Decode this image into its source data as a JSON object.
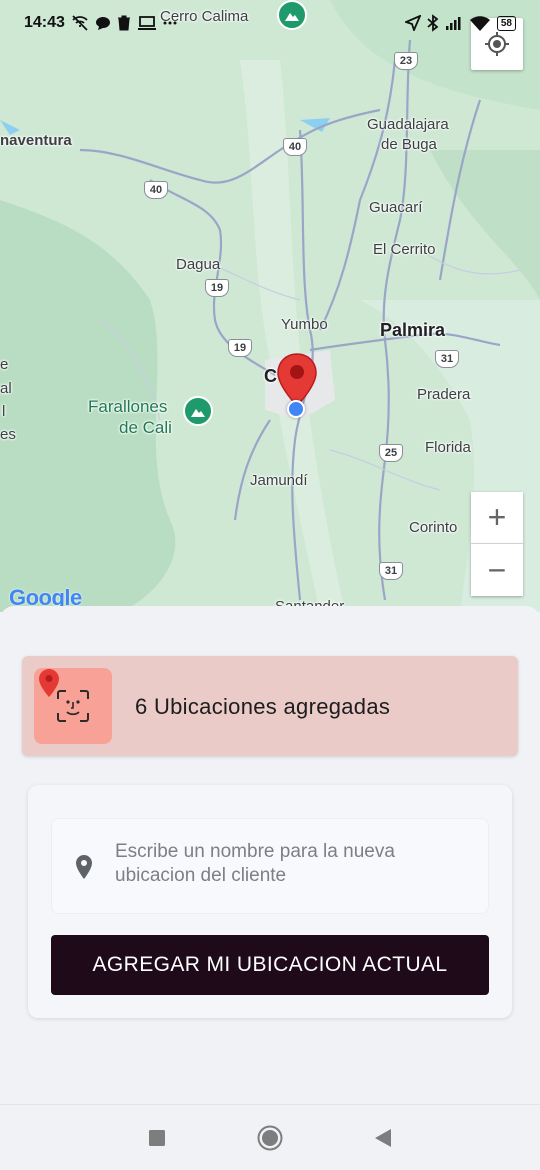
{
  "status_bar": {
    "time": "14:43",
    "battery": "58",
    "left_icons": [
      "wifi-off-icon",
      "chat-icon",
      "trash-icon",
      "laptop-icon",
      "more-icon"
    ],
    "right_icons": [
      "location-arrow-icon",
      "bluetooth-icon",
      "signal-icon",
      "wifi-icon",
      "battery-icon"
    ]
  },
  "map": {
    "places": [
      {
        "name": "Cerro Calima"
      },
      {
        "name": "naventura"
      },
      {
        "name": "Guadalajara"
      },
      {
        "name": "de Buga"
      },
      {
        "name": "Guacarí"
      },
      {
        "name": "El Cerrito"
      },
      {
        "name": "Dagua"
      },
      {
        "name": "Yumbo"
      },
      {
        "name": "Palmira"
      },
      {
        "name": "Pradera"
      },
      {
        "name": "Farallones"
      },
      {
        "name": "de Cali"
      },
      {
        "name": "Florida"
      },
      {
        "name": "Jamundí"
      },
      {
        "name": "Corinto"
      },
      {
        "name": "Santander"
      },
      {
        "name": "C"
      },
      {
        "name": "e"
      },
      {
        "name": "al"
      },
      {
        "name": "l"
      },
      {
        "name": "es"
      }
    ],
    "route_shields": [
      "23",
      "40",
      "40",
      "19",
      "19",
      "31",
      "25",
      "31"
    ],
    "zoom_in_label": "+",
    "zoom_out_label": "−",
    "attribution": "Google",
    "pin_color": "#e53935",
    "user_dot_color": "#4285f4"
  },
  "summary": {
    "text": "6 Ubicaciones agregadas",
    "card_color": "#eacbc8",
    "icon_box_color": "#f8a196"
  },
  "form": {
    "name_placeholder": "Escribe un nombre para la nueva ubicacion del cliente",
    "name_value": "",
    "submit_label": "AGREGAR MI UBICACION ACTUAL",
    "submit_color": "#1f0a1a"
  },
  "nav_bar": {
    "items": [
      "recents-square-icon",
      "home-circle-icon",
      "back-triangle-icon"
    ]
  }
}
